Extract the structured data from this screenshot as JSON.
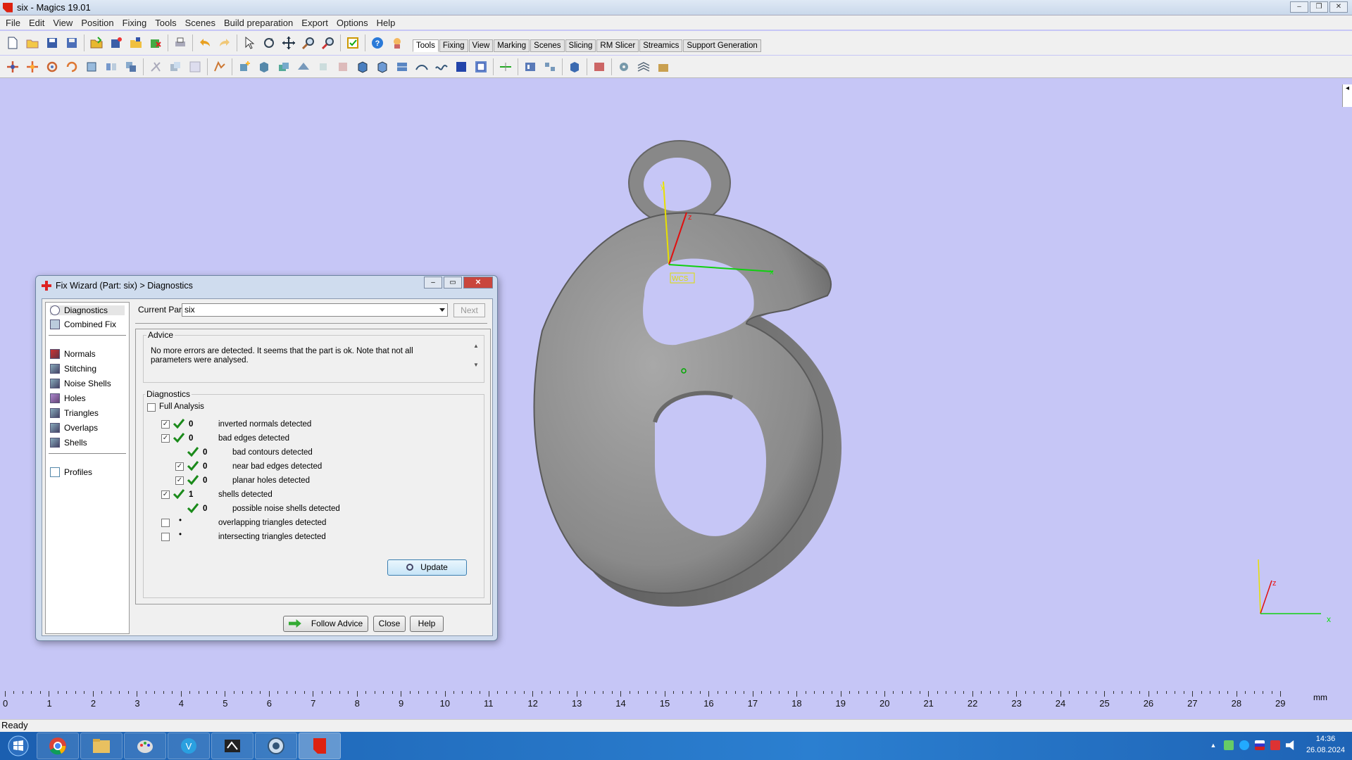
{
  "window": {
    "title": "six - Magics 19.01",
    "controls": [
      "–",
      "❐",
      "✕"
    ]
  },
  "menu": [
    "File",
    "Edit",
    "View",
    "Position",
    "Fixing",
    "Tools",
    "Scenes",
    "Build preparation",
    "Export",
    "Options",
    "Help"
  ],
  "ribbon_tabs": [
    "Tools",
    "Fixing",
    "View",
    "Marking",
    "Scenes",
    "Slicing",
    "RM Slicer",
    "Streamics",
    "Support Generation"
  ],
  "ribbon_active": "Tools",
  "dialog": {
    "title": "Fix Wizard (Part: six) > Diagnostics",
    "controls": [
      "–",
      "▭",
      "✕"
    ],
    "nav": {
      "diagnostics": "Diagnostics",
      "combined_fix": "Combined Fix",
      "normals": "Normals",
      "stitching": "Stitching",
      "noise_shells": "Noise Shells",
      "holes": "Holes",
      "triangles": "Triangles",
      "overlaps": "Overlaps",
      "shells": "Shells",
      "profiles": "Profiles"
    },
    "current_part_label": "Current Part:",
    "current_part_value": "six",
    "next_label": "Next",
    "advice_title": "Advice",
    "advice_text": "No more errors are detected. It seems that the part is ok. Note that not all parameters were analysed.",
    "diagnostics_title": "Diagnostics",
    "full_analysis_label": "Full Analysis",
    "rows": [
      {
        "count": "0",
        "label": "inverted normals detected"
      },
      {
        "count": "0",
        "label": "bad edges detected"
      },
      {
        "count": "0",
        "label": "bad contours detected"
      },
      {
        "count": "0",
        "label": "near bad edges detected"
      },
      {
        "count": "0",
        "label": "planar holes detected"
      },
      {
        "count": "1",
        "label": "shells detected"
      },
      {
        "count": "0",
        "label": "possible noise shells detected"
      },
      {
        "count": "•",
        "label": "overlapping triangles detected"
      },
      {
        "count": "•",
        "label": "intersecting triangles detected"
      }
    ],
    "update_label": "Update",
    "follow_advice_label": "Follow Advice",
    "close_label": "Close",
    "help_label": "Help"
  },
  "viewport": {
    "wcs_label": "WCS",
    "axis_labels": {
      "x": "x",
      "y": "y",
      "z": "z"
    }
  },
  "ruler": {
    "ticks": [
      "0",
      "1",
      "2",
      "3",
      "4",
      "5",
      "6",
      "7",
      "8",
      "9",
      "10",
      "11",
      "12",
      "13",
      "14",
      "15",
      "16",
      "17",
      "18",
      "19",
      "20",
      "21",
      "22",
      "23",
      "24",
      "25",
      "26",
      "27",
      "28",
      "29"
    ],
    "unit": "mm"
  },
  "status": "Ready",
  "clock": {
    "time": "14:36",
    "date": "26.08.2024"
  }
}
